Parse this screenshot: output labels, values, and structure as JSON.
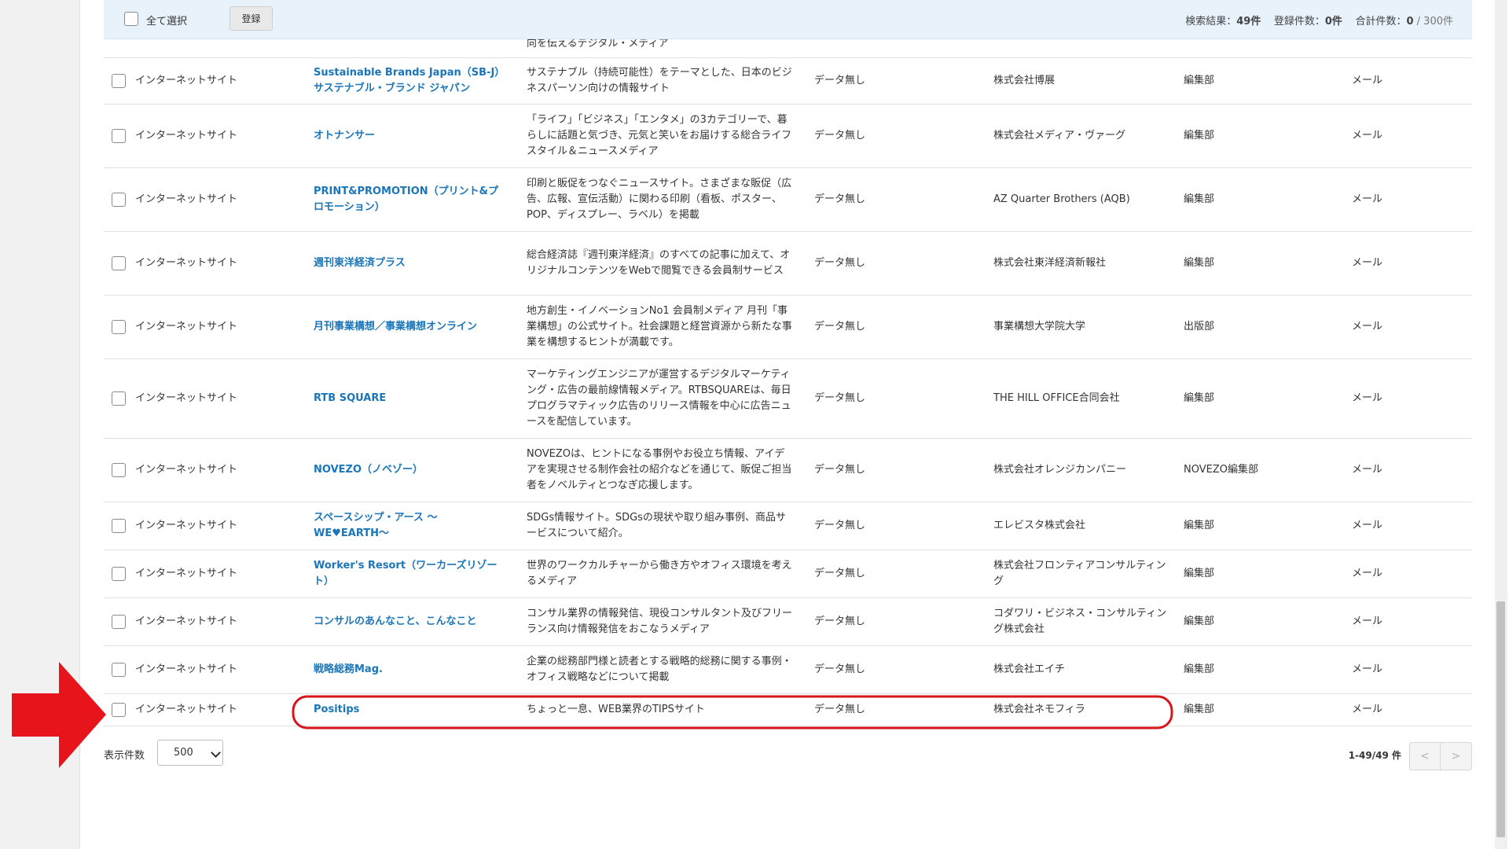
{
  "header": {
    "select_all_label": "全て選択",
    "register_button": "登録",
    "search_results_label": "検索結果：",
    "search_results_value": "49件",
    "registered_label": "登録件数：",
    "registered_value": "0件",
    "total_label": "合計件数：",
    "total_value": "0",
    "total_max": " / 300件"
  },
  "cut_row": {
    "desc": "向を伝えるデジタル・メディア"
  },
  "rows": [
    {
      "type": "インターネットサイト",
      "name": "Sustainable Brands Japan（SB-J）サステナブル・ブランド ジャパン",
      "desc": "サステナブル（持続可能性）をテーマとした、日本のビジネスパーソン向けの情報サイト",
      "data": "データ無し",
      "company": "株式会社博展",
      "dept": "編集部",
      "contact": "メール"
    },
    {
      "type": "インターネットサイト",
      "name": "オトナンサー",
      "desc": "「ライフ」「ビジネス」「エンタメ」の3カテゴリーで、暮らしに話題と気づき、元気と笑いをお届けする総合ライフスタイル＆ニュースメディア",
      "data": "データ無し",
      "company": "株式会社メディア・ヴァーグ",
      "dept": "編集部",
      "contact": "メール"
    },
    {
      "type": "インターネットサイト",
      "name": "PRINT&PROMOTION（プリント&プロモーション）",
      "desc": "印刷と販促をつなぐニュースサイト。さまざまな販促（広告、広報、宣伝活動）に関わる印刷（看板、ポスター、POP、ディスプレー、ラベル）を掲載",
      "data": "データ無し",
      "company": "AZ Quarter Brothers (AQB)",
      "dept": "編集部",
      "contact": "メール"
    },
    {
      "type": "インターネットサイト",
      "name": "週刊東洋経済プラス",
      "desc": "総合経済誌『週刊東洋経済』のすべての記事に加えて、オリジナルコンテンツをWebで閲覧できる会員制サービス",
      "data": "データ無し",
      "company": "株式会社東洋経済新報社",
      "dept": "編集部",
      "contact": "メール"
    },
    {
      "type": "インターネットサイト",
      "name": "月刊事業構想／事業構想オンライン",
      "desc": "地方創生・イノベーションNo1 会員制メディア 月刊「事業構想」の公式サイト。社会課題と経営資源から新たな事業を構想するヒントが満載です。",
      "data": "データ無し",
      "company": "事業構想大学院大学",
      "dept": "出版部",
      "contact": "メール"
    },
    {
      "type": "インターネットサイト",
      "name": "RTB SQUARE",
      "desc": "マーケティングエンジニアが運営するデジタルマーケティング・広告の最前線情報メディア。RTBSQUAREは、毎日プログラマティック広告のリリース情報を中心に広告ニュースを配信しています。",
      "data": "データ無し",
      "company": "THE HILL OFFICE合同会社",
      "dept": "編集部",
      "contact": "メール"
    },
    {
      "type": "インターネットサイト",
      "name": "NOVEZO（ノベゾー）",
      "desc": "NOVEZOは、ヒントになる事例やお役立ち情報、アイデアを実現させる制作会社の紹介などを通じて、販促ご担当者をノベルティとつなぎ応援します。",
      "data": "データ無し",
      "company": "株式会社オレンジカンパニー",
      "dept": "NOVEZO編集部",
      "contact": "メール"
    },
    {
      "type": "インターネットサイト",
      "name": "スペースシップ・アース ～WE♥EARTH～",
      "desc": "SDGs情報サイト。SDGsの現状や取り組み事例、商品サービスについて紹介。",
      "data": "データ無し",
      "company": "エレビスタ株式会社",
      "dept": "編集部",
      "contact": "メール"
    },
    {
      "type": "インターネットサイト",
      "name": "Worker's Resort（ワーカーズリゾート）",
      "desc": "世界のワークカルチャーから働き方やオフィス環境を考えるメディア",
      "data": "データ無し",
      "company": "株式会社フロンティアコンサルティング",
      "dept": "編集部",
      "contact": "メール"
    },
    {
      "type": "インターネットサイト",
      "name": "コンサルのあんなこと、こんなこと",
      "desc": "コンサル業界の情報発信、現役コンサルタント及びフリーランス向け情報発信をおこなうメディア",
      "data": "データ無し",
      "company": "コダワリ・ビジネス・コンサルティング株式会社",
      "dept": "編集部",
      "contact": "メール"
    },
    {
      "type": "インターネットサイト",
      "name": "戦略総務Mag.",
      "desc": "企業の総務部門様と読者とする戦略的総務に関する事例・オフィス戦略などについて掲載",
      "data": "データ無し",
      "company": "株式会社エイチ",
      "dept": "編集部",
      "contact": "メール"
    },
    {
      "type": "インターネットサイト",
      "name": "Positips",
      "desc": "ちょっと一息、WEB業界のTIPSサイト",
      "data": "データ無し",
      "company": "株式会社ネモフィラ",
      "dept": "編集部",
      "contact": "メール"
    }
  ],
  "footer": {
    "per_page_label": "表示件数",
    "per_page_value": "500",
    "range_text": "1-49/49 件",
    "prev_label": "<",
    "next_label": ">"
  },
  "annotation_colors": {
    "arrow": "#e8141c",
    "highlight": "#d9151c"
  }
}
